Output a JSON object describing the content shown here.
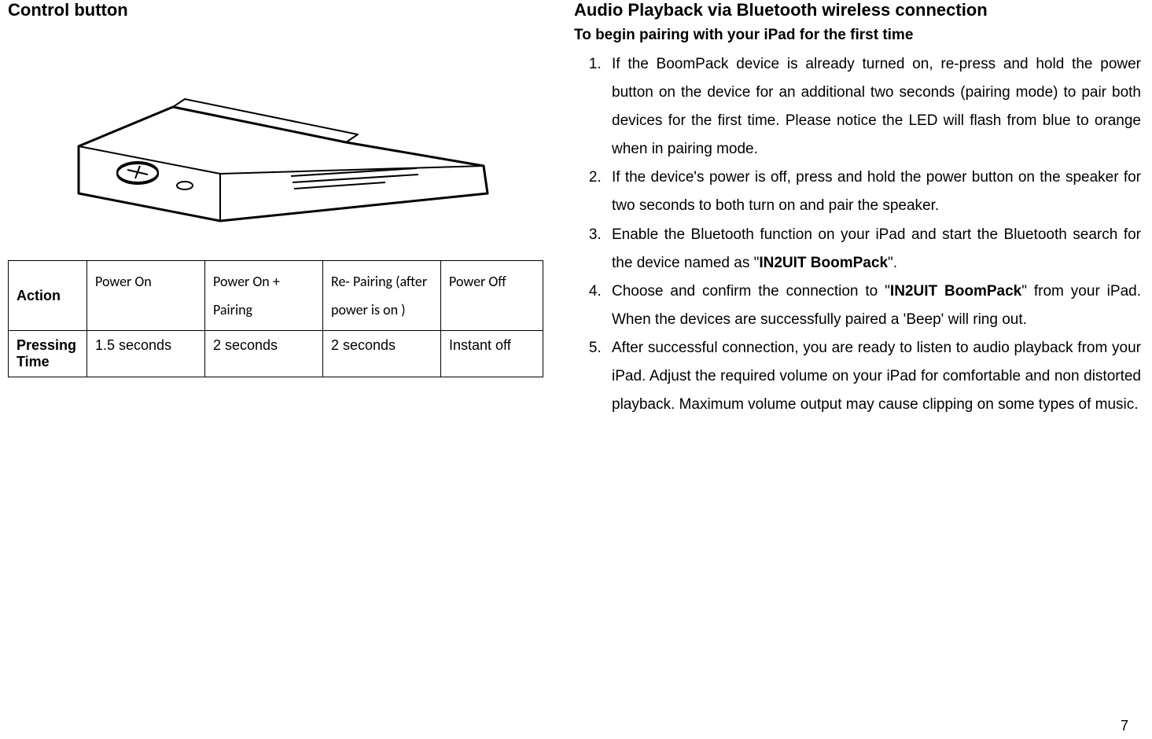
{
  "left": {
    "heading": "Control button",
    "table": {
      "row1_label": "Action",
      "row1_c1": "Power On",
      "row1_c2": "Power On + Pairing",
      "row1_c3": "Re- Pairing (after power is on )",
      "row1_c4": "Power Off",
      "row2_label": "Pressing Time",
      "row2_c1": "1.5 seconds",
      "row2_c2": "2 seconds",
      "row2_c3": "2 seconds",
      "row2_c4": "Instant off"
    }
  },
  "right": {
    "heading": "Audio Playback via Bluetooth wireless connection",
    "subheading": "To begin pairing with your iPad for the first time",
    "steps": {
      "s1": "If the BoomPack device is already turned on, re-press and hold the power button on the device for an additional two seconds (pairing mode) to pair both devices for the first time. Please notice the LED will flash from blue to orange when in pairing mode.",
      "s2": "If the device's power is off, press and hold the power button on the speaker for two seconds to both turn on and pair the speaker.",
      "s3_a": "Enable the Bluetooth function on your iPad and start the Bluetooth search for the device named as \"",
      "s3_bold": "IN2UIT BoomPack",
      "s3_b": "\".",
      "s4_a": "Choose and confirm the connection to \"",
      "s4_bold": "IN2UIT BoomPack",
      "s4_b": "\" from your iPad. When the devices are successfully paired a 'Beep' will ring out.",
      "s5": "After successful connection, you are ready to listen to audio playback from your iPad. Adjust the required volume on your iPad for comfortable and non distorted playback. Maximum volume output may cause clipping on some types of music."
    }
  },
  "page_number": "7"
}
